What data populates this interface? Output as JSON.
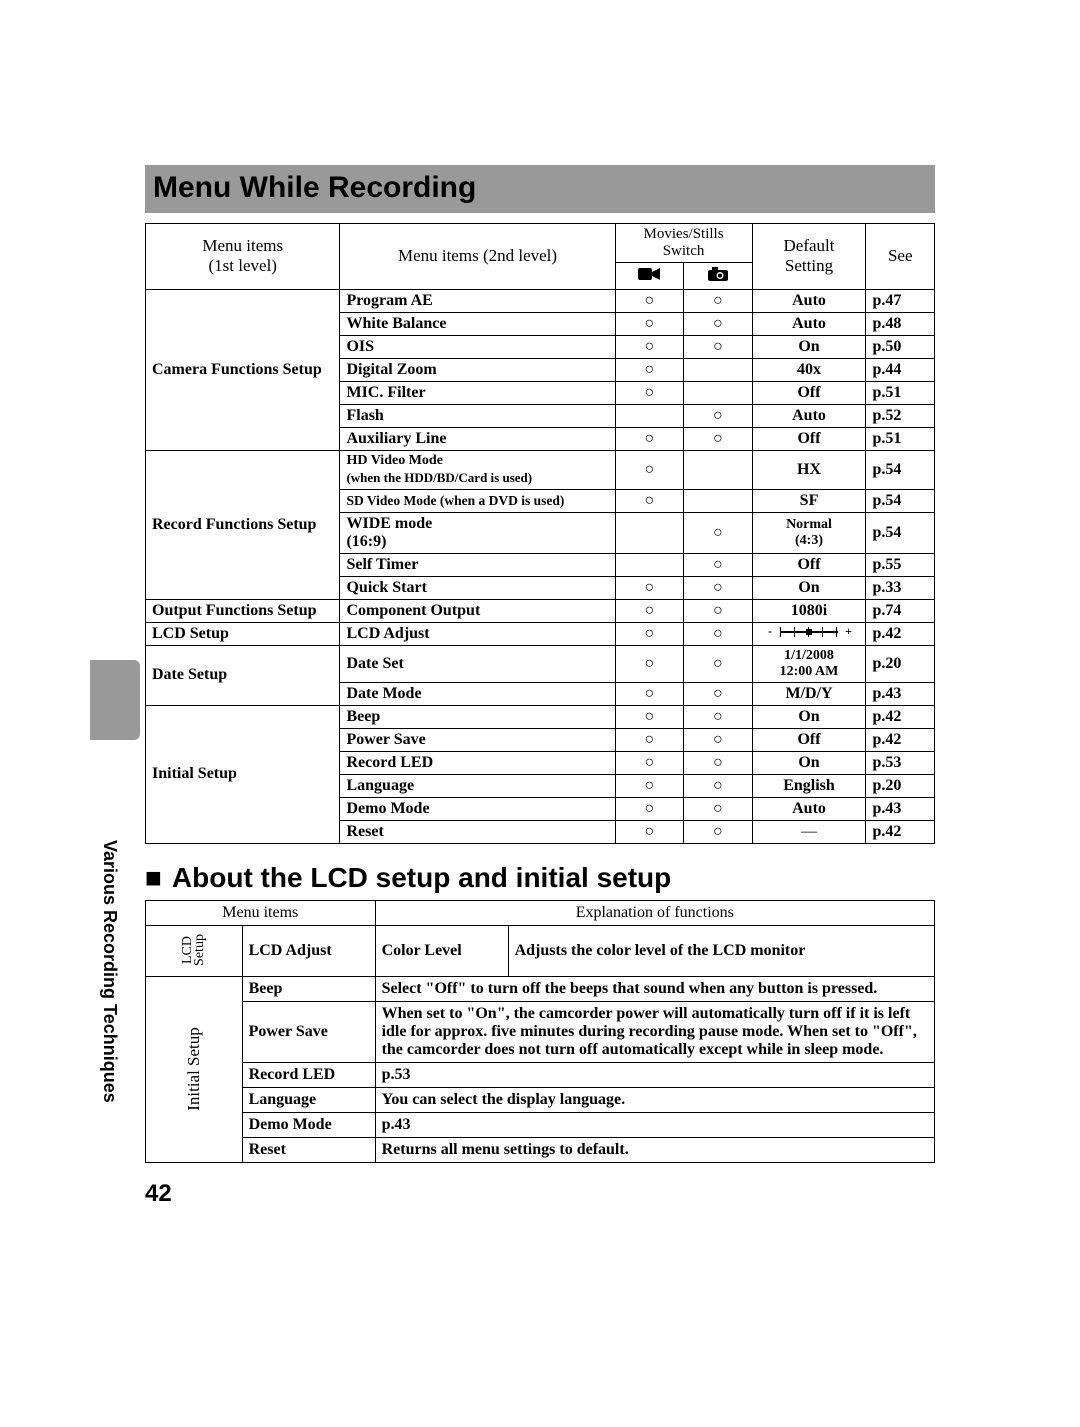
{
  "titleBar": "Menu While Recording",
  "sideLabel": "Various Recording Techniques",
  "pageNumber": "42",
  "table1": {
    "headers": {
      "col1a": "Menu items",
      "col1b": "(1st level)",
      "col2": "Menu items (2nd level)",
      "col34": "Movies/Stills Switch",
      "col5a": "Default",
      "col5b": "Setting",
      "col6": "See"
    },
    "groups": [
      {
        "name": "Camera Functions Setup",
        "rows": [
          {
            "item": "Program AE",
            "m": true,
            "s": true,
            "def": "Auto",
            "see": "p.47"
          },
          {
            "item": "White Balance",
            "m": true,
            "s": true,
            "def": "Auto",
            "see": "p.48"
          },
          {
            "item": "OIS",
            "m": true,
            "s": true,
            "def": "On",
            "see": "p.50"
          },
          {
            "item": "Digital Zoom",
            "m": true,
            "s": false,
            "def": "40x",
            "see": "p.44"
          },
          {
            "item": "MIC. Filter",
            "m": true,
            "s": false,
            "def": "Off",
            "see": "p.51"
          },
          {
            "item": "Flash",
            "m": false,
            "s": true,
            "def": "Auto",
            "see": "p.52"
          },
          {
            "item": "Auxiliary Line",
            "m": true,
            "s": true,
            "def": "Off",
            "see": "p.51"
          }
        ]
      },
      {
        "name": "Record Functions Setup",
        "rows": [
          {
            "item": "HD Video Mode",
            "note": "(when the HDD/BD/Card is used)",
            "m": true,
            "s": false,
            "def": "HX",
            "see": "p.54"
          },
          {
            "item": "SD Video Mode (when a DVD is used)",
            "small": true,
            "m": true,
            "s": false,
            "def": "SF",
            "see": "p.54"
          },
          {
            "item": "WIDE mode",
            "note2": "(16:9)",
            "m": false,
            "s": true,
            "def": "Normal",
            "defNote": "(4:3)",
            "see": "p.54"
          },
          {
            "item": "Self Timer",
            "m": false,
            "s": true,
            "def": "Off",
            "see": "p.55"
          },
          {
            "item": "Quick Start",
            "m": true,
            "s": true,
            "def": "On",
            "see": "p.33"
          }
        ]
      },
      {
        "name": "Output Functions Setup",
        "rows": [
          {
            "item": "Component Output",
            "m": true,
            "s": true,
            "def": "1080i",
            "see": "p.74"
          }
        ]
      },
      {
        "name": "LCD Setup",
        "rows": [
          {
            "item": "LCD Adjust",
            "m": true,
            "s": true,
            "slider": true,
            "see": "p.42"
          }
        ]
      },
      {
        "name": "Date Setup",
        "rows": [
          {
            "item": "Date Set",
            "m": true,
            "s": true,
            "def": "1/1/2008",
            "defNote": "12:00 AM",
            "see": "p.20"
          },
          {
            "item": "Date Mode",
            "m": true,
            "s": true,
            "def": "M/D/Y",
            "see": "p.43"
          }
        ]
      },
      {
        "name": "Initial Setup",
        "rows": [
          {
            "item": "Beep",
            "m": true,
            "s": true,
            "def": "On",
            "see": "p.42"
          },
          {
            "item": "Power Save",
            "m": true,
            "s": true,
            "def": "Off",
            "see": "p.42"
          },
          {
            "item": "Record LED",
            "m": true,
            "s": true,
            "def": "On",
            "see": "p.53"
          },
          {
            "item": "Language",
            "m": true,
            "s": true,
            "def": "English",
            "see": "p.20"
          },
          {
            "item": "Demo Mode",
            "m": true,
            "s": true,
            "def": "Auto",
            "see": "p.43"
          },
          {
            "item": "Reset",
            "m": true,
            "s": true,
            "def": "—",
            "see": "p.42"
          }
        ]
      }
    ]
  },
  "sectionHeading": "About the LCD setup and initial setup",
  "table2": {
    "headers": {
      "c1": "Menu items",
      "c2": "Explanation of functions"
    },
    "lcdGroup": {
      "label1": "LCD",
      "label2": "Setup",
      "row": {
        "item": "LCD Adjust",
        "sub": "Color Level",
        "expl": "Adjusts the color level of the LCD monitor"
      }
    },
    "initialGroup": {
      "label": "Initial Setup",
      "rows": [
        {
          "item": "Beep",
          "expl": "Select \"Off\" to turn off the beeps that sound when any button is pressed."
        },
        {
          "item": "Power Save",
          "expl": "When set to \"On\", the camcorder power will automatically turn off if it is left idle for approx. five minutes during recording pause mode. When set to \"Off\", the camcorder does not turn off automatically except while in sleep mode."
        },
        {
          "item": "Record LED",
          "expl": "p.53"
        },
        {
          "item": "Language",
          "expl": "You can select the display language."
        },
        {
          "item": "Demo Mode",
          "expl": "p.43"
        },
        {
          "item": "Reset",
          "expl": "Returns all menu settings to default."
        }
      ]
    }
  }
}
